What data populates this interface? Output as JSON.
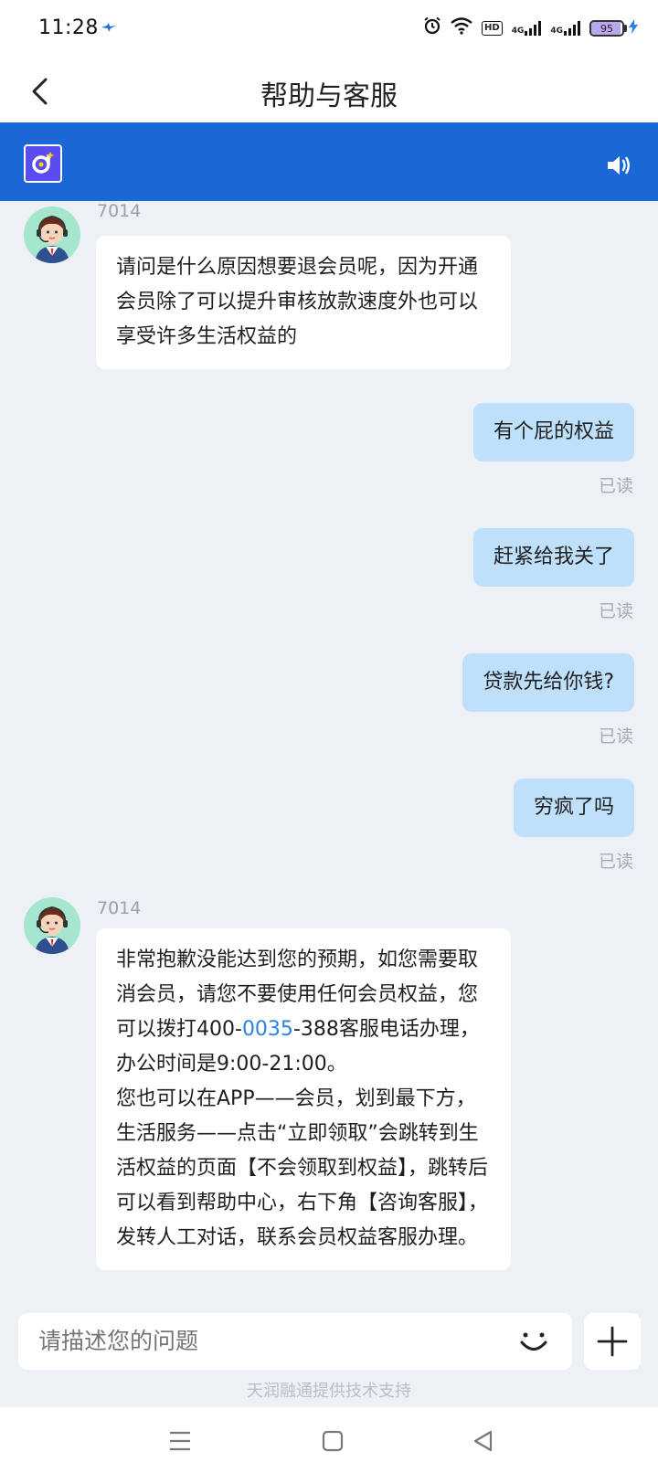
{
  "status_bar": {
    "time": "11:28",
    "battery": "95",
    "battery_level": 0.95,
    "network_1": "4G",
    "network_2": "4G",
    "hd": "HD"
  },
  "header": {
    "title": "帮助与客服"
  },
  "messages": {
    "agent1": {
      "agent_id": "7014",
      "text": "请问是什么原因想要退会员呢，因为开通会员除了可以提升审核放款速度外也可以享受许多生活权益的"
    },
    "out1": {
      "text": "有个屁的权益",
      "status": "已读"
    },
    "out2": {
      "text": "赶紧给我关了",
      "status": "已读"
    },
    "out3": {
      "text": "贷款先给你钱?",
      "status": "已读"
    },
    "out4": {
      "text": "穷疯了吗",
      "status": "已读"
    },
    "agent2": {
      "agent_id": "7014",
      "text_before_link": "非常抱歉没能达到您的预期，如您需要取消会员，请您不要使用任何会员权益，您可以拨打400-",
      "phone_link": "0035",
      "text_after_link": "-388客服电话办理，办公时间是9:00-21:00。",
      "text_para2": "您也可以在APP——会员，划到最下方，生活服务——点击“立即领取”会跳转到生活权益的页面【不会领取到权益】，跳转后可以看到帮助中心，右下角【咨询客服】，发转人工对话，联系会员权益客服办理。"
    }
  },
  "input": {
    "placeholder": "请描述您的问题"
  },
  "footer": {
    "powered_by": "天润融通提供技术支持"
  },
  "colors": {
    "banner": "#1b68d5",
    "outgoing_bubble": "#bfe0fb",
    "incoming_bubble": "#ffffff",
    "chat_background": "#edf1f6",
    "link": "#2a82e6"
  }
}
